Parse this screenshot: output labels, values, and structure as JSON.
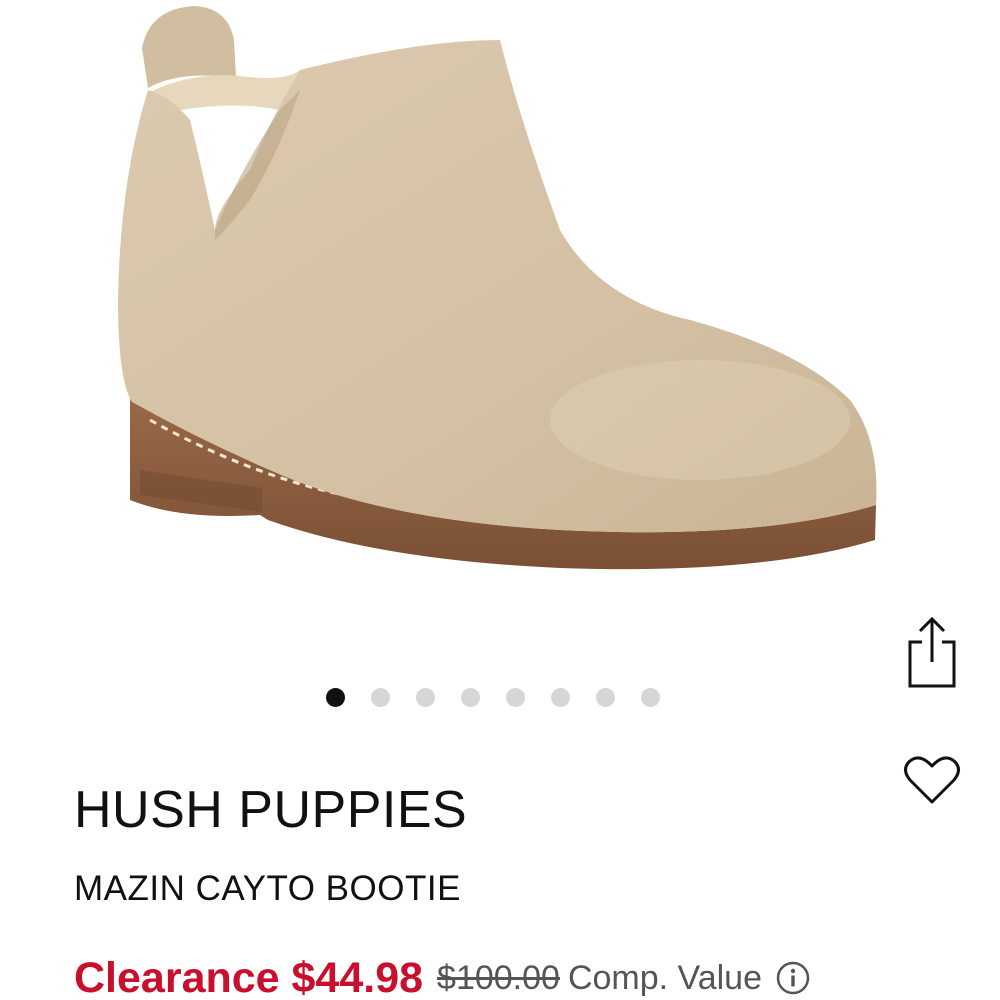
{
  "product": {
    "brand": "HUSH PUPPIES",
    "name": "MAZIN CAYTO BOOTIE",
    "image_alt": "tan suede ankle bootie",
    "colors": {
      "suede": "#d6c3a6",
      "sole": "#8a5a3c",
      "lining": "#e7d8bd"
    }
  },
  "gallery": {
    "total_images": 8,
    "active_index": 0
  },
  "pricing": {
    "sale_label": "Clearance $44.98",
    "original_price": "$100.00",
    "comp_label": "Comp. Value",
    "sale_color": "#c8102e"
  },
  "actions": {
    "share_icon": "share-icon",
    "favorite_icon": "heart-icon",
    "info_icon": "info-icon"
  }
}
